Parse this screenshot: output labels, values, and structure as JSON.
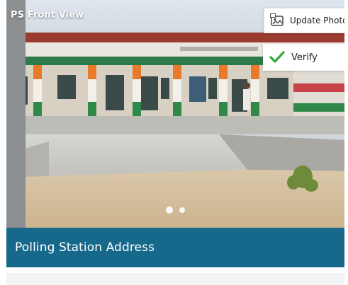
{
  "photo": {
    "label": "PS Front View",
    "slide_count": 2,
    "active_slide": 1
  },
  "actions": {
    "update_photo": {
      "label": "Update Photo",
      "icon": "image-upload-icon"
    },
    "verify": {
      "label": "Verify",
      "icon": "check-icon",
      "icon_color": "#2eaa3a"
    }
  },
  "section": {
    "title": "Polling Station Address",
    "color": "#17698c"
  }
}
